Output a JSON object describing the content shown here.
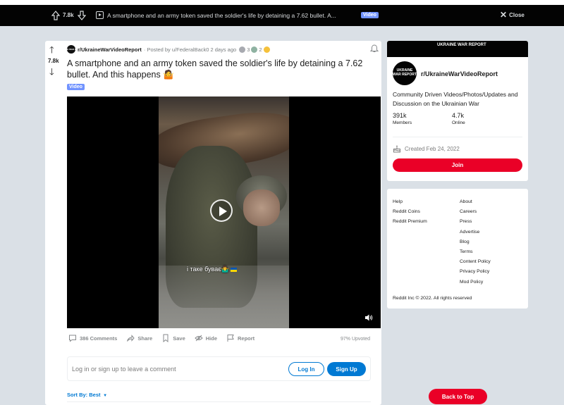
{
  "topbar": {
    "score": "7.8k",
    "title": "A smartphone and an army token saved the soldier's life by detaining a 7.62 bullet. A...",
    "flair": "Video",
    "close_label": "Close"
  },
  "post": {
    "score": "7.8k",
    "subreddit": "r/UkraineWarVideoReport",
    "subreddit_logo_text": "UKRAINE WAR REPORT",
    "posted_by": "· Posted by u/FederalBack0 2 days ago",
    "award_counts": [
      "3",
      "2"
    ],
    "title": "A smartphone and an army token saved the soldier's life by detaining a 7.62 bullet. And this happens 🤷",
    "flair": "Video",
    "video_caption": "і таке буває🤷‍♂️",
    "actions": {
      "comments": "386 Comments",
      "share": "Share",
      "save": "Save",
      "hide": "Hide",
      "report": "Report"
    },
    "upvoted": "97% Upvoted"
  },
  "comment": {
    "prompt": "Log in or sign up to leave a comment",
    "login": "Log In",
    "signup": "Sign Up",
    "sort_by": "Sort By: Best"
  },
  "sidebar": {
    "banner_text": "UKRAINE WAR REPORT",
    "logo_text": "UKRAINE WAR REPORT",
    "name": "r/UkraineWarVideoReport",
    "description": "Community Driven Videos/Photos/Updates and Discussion on the Ukrainian War",
    "members_count": "391k",
    "members_label": "Members",
    "online_count": "4.7k",
    "online_label": "Online",
    "created": "Created Feb 24, 2022",
    "join": "Join"
  },
  "footer": {
    "links_left": [
      "Help",
      "Reddit Coins",
      "Reddit Premium"
    ],
    "links_right": [
      "About",
      "Careers",
      "Press",
      "Advertise",
      "Blog",
      "Terms",
      "Content Policy",
      "Privacy Policy",
      "Mod Policy"
    ],
    "copyright": "Reddit Inc © 2022. All rights reserved",
    "back_to_top": "Back to Top"
  },
  "colors": {
    "background": "#dae0e6",
    "header": "#030303",
    "primary_blue": "#0079d3",
    "join_red": "#ea0027",
    "flair": "#7193ff"
  }
}
